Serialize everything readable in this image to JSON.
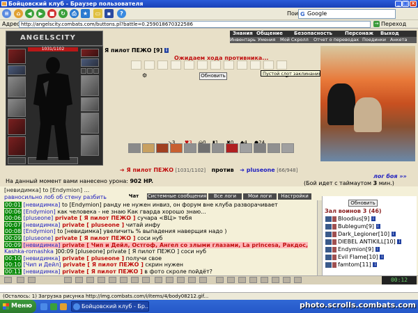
{
  "window": {
    "title": "Бойцовский клуб - Браузер пользователя"
  },
  "search": {
    "label": "Поиск:",
    "value": "Google"
  },
  "address": {
    "label": "Адрес:",
    "url": "http://angelscity.combats.com/buttons.pl?battle=0.259018670322586",
    "go_label": "Переход"
  },
  "site": {
    "logo": "ANGELSCITY",
    "nav_top": [
      "Знания",
      "Общение",
      "Безопасность",
      "Персонаж",
      "Выход"
    ],
    "nav_bottom": [
      "Инвентарь",
      "Умения",
      "Мой Скролл",
      "Отчет о переводах",
      "Поединки",
      "Анкета"
    ]
  },
  "player": {
    "hp_text": "1031/1102",
    "name": "Я пилот ПЕЖО [9]"
  },
  "battle": {
    "waiting": "Ожидаем хода противника...",
    "refresh": "Обновить",
    "tooltip": "Пустой слот заклинания",
    "counters": [
      "3",
      "3",
      "0",
      "1",
      "0",
      "4",
      "24"
    ],
    "me": "Я пилот ПЕЖО",
    "me_hp": "[1031/1102]",
    "vs": "против",
    "enemy": "pluseone",
    "enemy_hp": "[66/948]",
    "fight_log": "лог боя »»",
    "damage_text": "На данный момент вами нанесено урона:",
    "damage_value": "902 HP.",
    "timeout_text": "(Бой идет с таймаутом",
    "timeout_value": "3",
    "timeout_unit": "мин.)"
  },
  "chat": {
    "first_line": "[невидимка] to [Endymion] ...",
    "second_line": "равносильно лоб об стену разбить",
    "tabs": [
      "Чат",
      "Системные сообщения",
      "Все логи",
      "Мои логи",
      "Настройки"
    ],
    "lines": [
      {
        "time": "00:01",
        "name": "[невидимка]",
        "text": " to [Endymion] ранду не нужен инвиз, он форум вне клуба разворачивает"
      },
      {
        "time": "00:06",
        "name": "[Endymion]",
        "text": " как человека - не знаю Как гварда хорошо знаю..."
      },
      {
        "time": "00:06",
        "name": "[pluseone]",
        "priv": " private [ Я пилот ПЕЖО ]",
        "text": " сучара <ВЦ> тебя"
      },
      {
        "time": "00:07",
        "name": "[невидимка]",
        "priv": " private [ pluseone ]",
        "text": " читай инфу"
      },
      {
        "time": "00:08",
        "name": "[Endymion]",
        "text": " to [невидимка] увеличить % выпадения наверщия надо )"
      },
      {
        "time": "00:09",
        "name": "[pluseone]",
        "priv": " private [ Я пилот ПЕЖО ]",
        "text": " соси нуб"
      },
      {
        "time": "00:09",
        "name": "[невидимка]",
        "priv": " private [ Чип и Дейл, Остгоф, Ангел со злыми глазами, La princesa, Ракдос,",
        "hl": true
      },
      {
        "time": "",
        "name": "Kashka-romashka",
        "text": " ]00:09 [pluseone] private [ Я пилот ПЕЖО ] соси нуб"
      },
      {
        "time": "00:10",
        "name": "[невидимка]",
        "priv": " private [ pluseone ]",
        "text": " получи свое"
      },
      {
        "time": "00:10",
        "name": "[Чип и Дейл]",
        "priv": " private [ Я пилот ПЕЖО ]",
        "text": " скрин нужен"
      },
      {
        "time": "00:11",
        "name": "[невидимка]",
        "priv": " private [ Я пилот ПЕЖО ]",
        "text": " в фото скроле пойдёт?"
      }
    ]
  },
  "room": {
    "refresh": "Обновить",
    "title": "Зал воинов 3 (46)",
    "players": [
      "Bloodius[9]",
      "Bublegum[9]",
      "Dark_Legioner[10]",
      "DIEBEL ANTIKILL[10]",
      "Endymion[9]",
      "Evil Flame[10]",
      "famtom[11]"
    ]
  },
  "bottom": {
    "clock": "00:12"
  },
  "status": {
    "text": "(Осталось: 1) Загрузка рисунка http://img.combats.com/i/items/4/body08212.gif..."
  },
  "taskbar": {
    "start": "Меню",
    "window": "Бойцовский клуб - Бр..."
  },
  "watermark": "photo.scrolls.combats.com"
}
